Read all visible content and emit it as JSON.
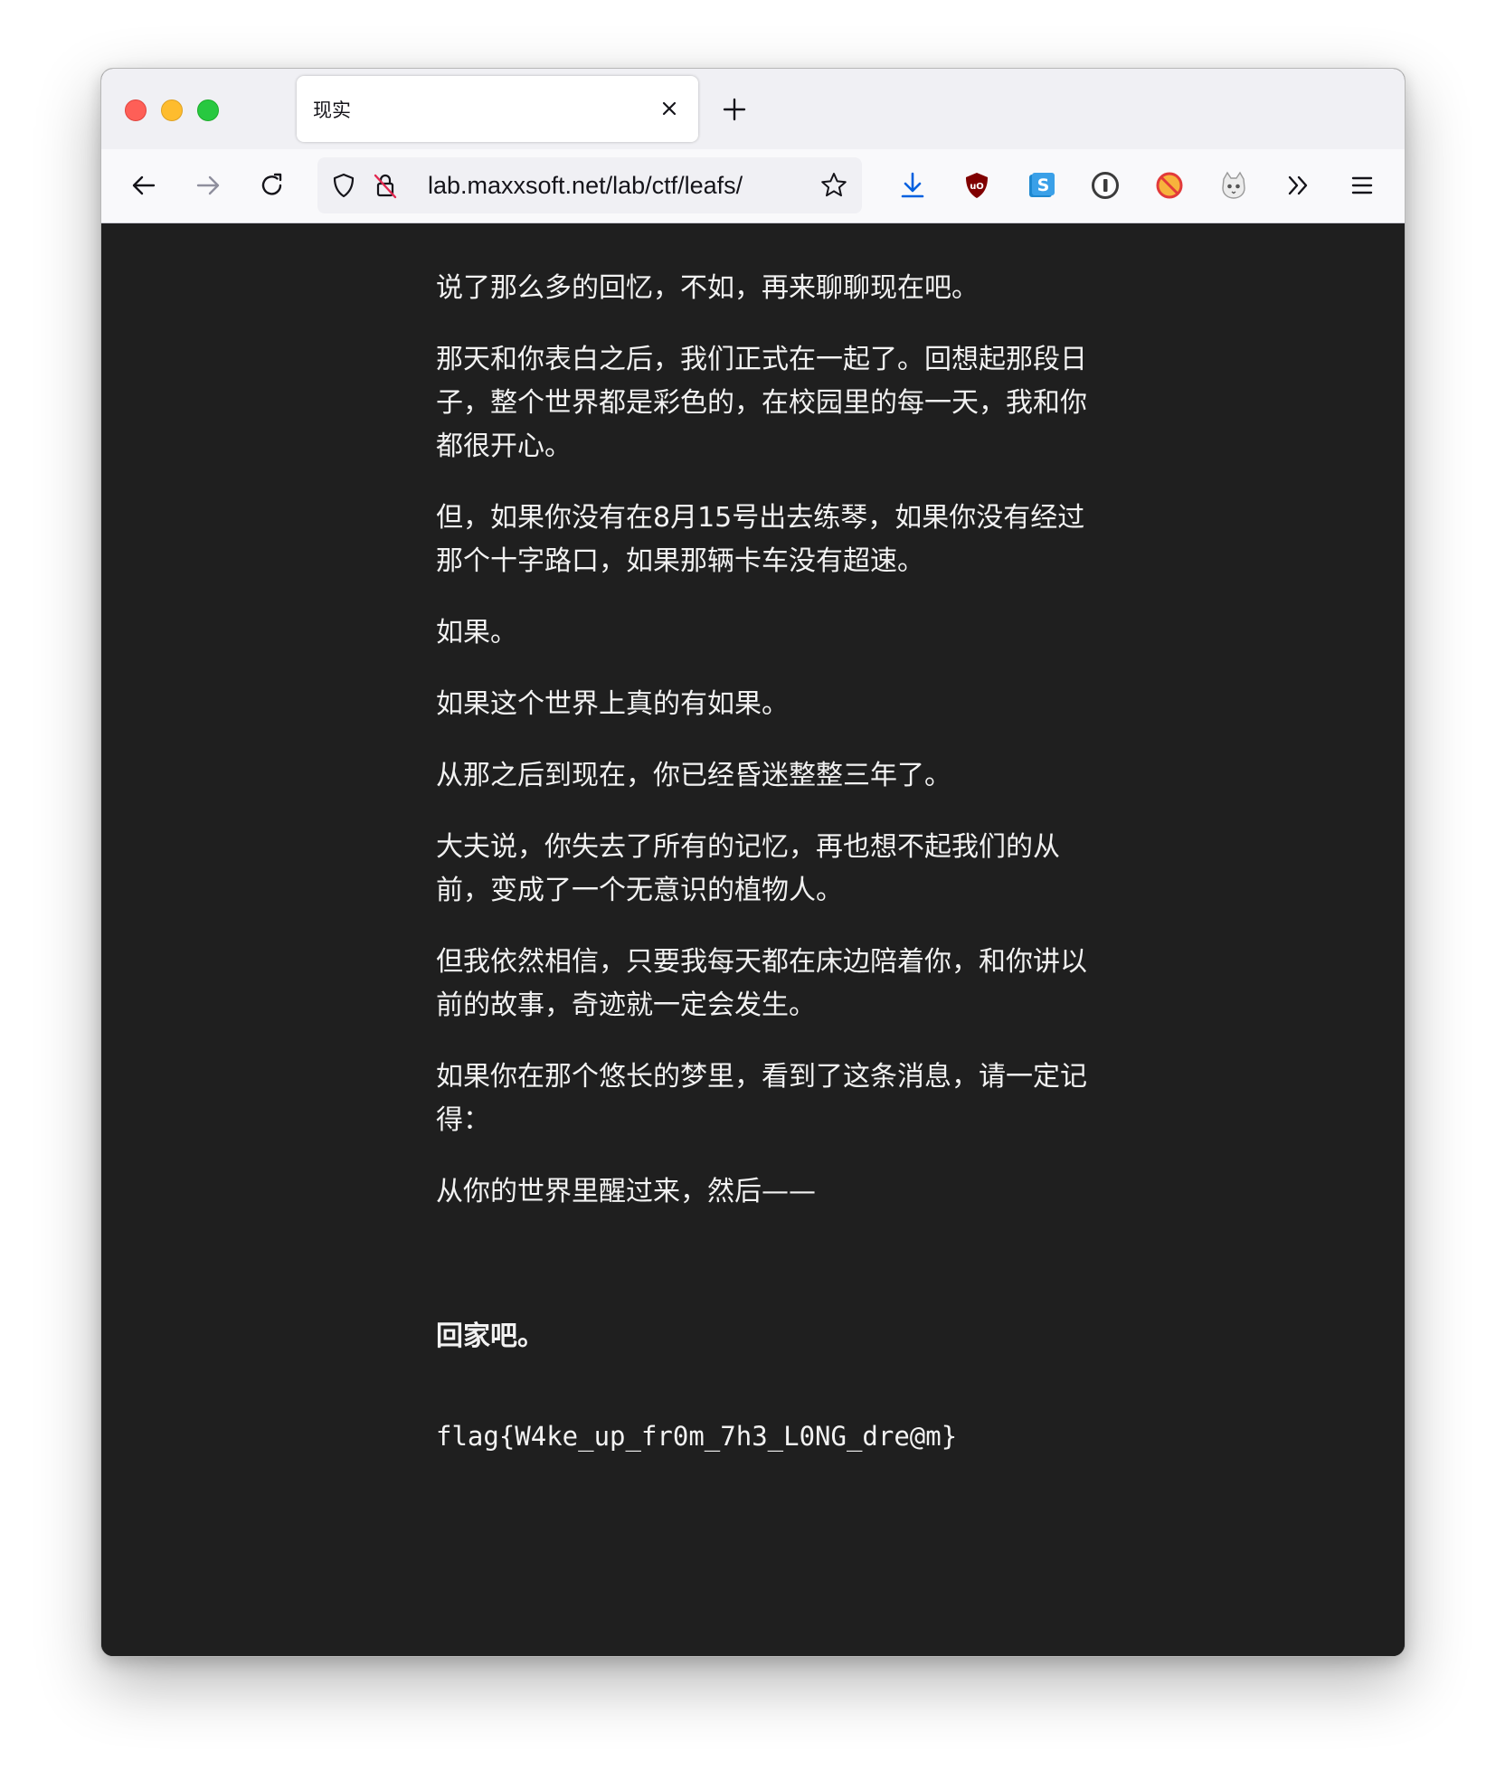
{
  "browser": {
    "tab_title": "现实",
    "url": "lab.maxxsoft.net/lab/ctf/leafs/"
  },
  "toolbar_icons": [
    "back-arrow-icon",
    "forward-arrow-icon",
    "reload-icon",
    "shield-icon",
    "insecure-lock-icon",
    "bookmark-star-icon",
    "download-icon",
    "ublock-origin-icon",
    "s-extension-icon",
    "1password-icon",
    "blocked-extension-icon",
    "cat-extension-icon",
    "overflow-chevrons-icon",
    "hamburger-menu-icon"
  ],
  "page": {
    "paragraphs": [
      "说了那么多的回忆，不如，再来聊聊现在吧。",
      "那天和你表白之后，我们正式在一起了。回想起那段日子，整个世界都是彩色的，在校园里的每一天，我和你都很开心。",
      "但，如果你没有在8月15号出去练琴，如果你没有经过那个十字路口，如果那辆卡车没有超速。",
      "如果。",
      "如果这个世界上真的有如果。",
      "从那之后到现在，你已经昏迷整整三年了。",
      "大夫说，你失去了所有的记忆，再也想不起我们的从前，变成了一个无意识的植物人。",
      "但我依然相信，只要我每天都在床边陪着你，和你讲以前的故事，奇迹就一定会发生。",
      "如果你在那个悠长的梦里，看到了这条消息，请一定记得：",
      "从你的世界里醒过来，然后——"
    ],
    "final_line": "回家吧。",
    "flag": "flag{W4ke_up_fr0m_7h3_L0NG_dre@m}"
  },
  "colors": {
    "page_background": "#1f1f1f",
    "text": "#f2f2f2",
    "toolbar_background": "#f9f9fb",
    "tabstrip_background": "#f0f0f4",
    "download_icon": "#0060df",
    "ublock_icon": "#800000",
    "s_extension_icon": "#1e88d0"
  }
}
